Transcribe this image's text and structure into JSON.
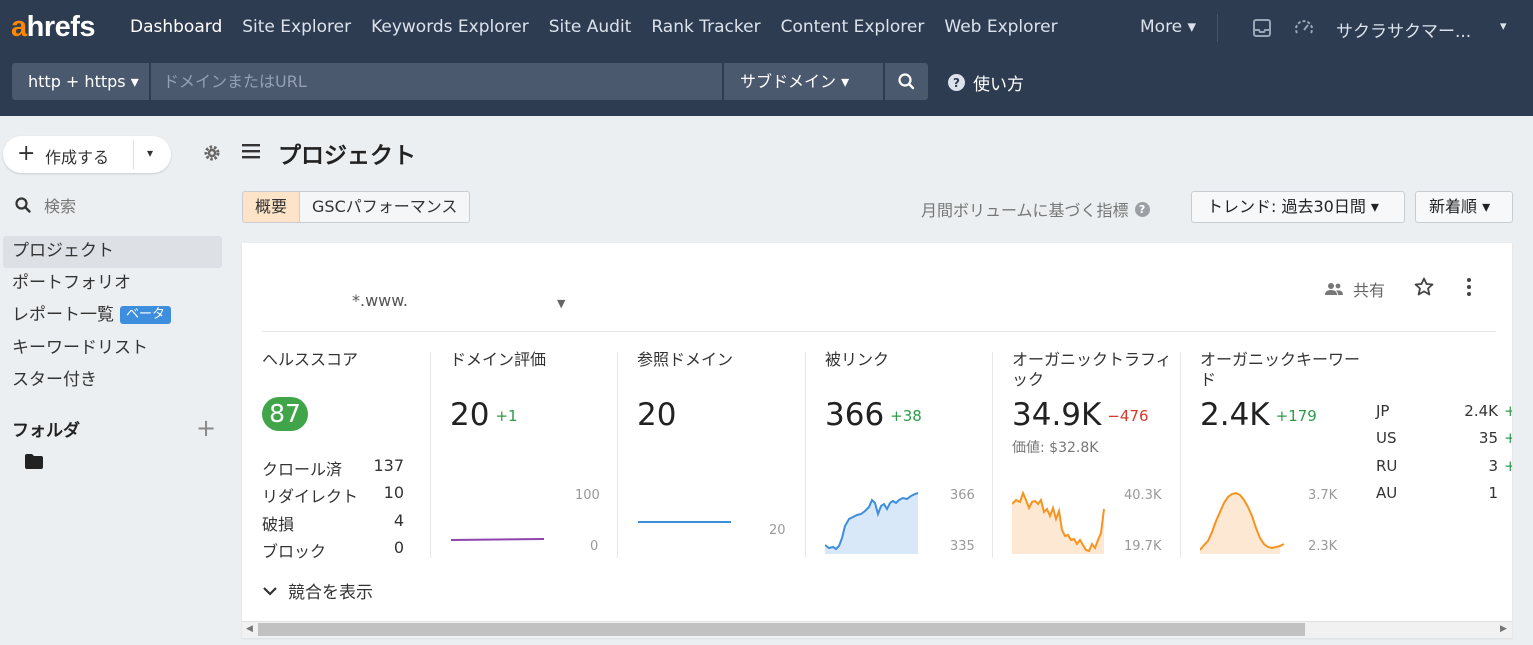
{
  "topnav": {
    "logo_a": "a",
    "logo_rest": "hrefs",
    "items": [
      {
        "label": "Dashboard",
        "active": true
      },
      {
        "label": "Site Explorer"
      },
      {
        "label": "Keywords Explorer"
      },
      {
        "label": "Site Audit"
      },
      {
        "label": "Rank Tracker"
      },
      {
        "label": "Content Explorer"
      },
      {
        "label": "Web Explorer"
      }
    ],
    "more": "More ▾",
    "account": "サクラサクマー...",
    "account_caret": "▾"
  },
  "searchbar": {
    "protocol": "http + https ▾",
    "placeholder": "ドメインまたはURL",
    "mode": "サブドメイン ▾",
    "help": "使い方",
    "help_glyph": "?"
  },
  "sidebar": {
    "create_plus": "+",
    "create_label": "作成する",
    "create_caret": "▾",
    "search_label": "検索",
    "items": [
      {
        "label": "プロジェクト",
        "active": true
      },
      {
        "label": "ポートフォリオ"
      },
      {
        "label": "レポート一覧",
        "badge": "ベータ"
      },
      {
        "label": "キーワードリスト"
      },
      {
        "label": "スター付き"
      }
    ],
    "folder_heading": "フォルダ",
    "folder_add": "+"
  },
  "main": {
    "title": "プロジェクト",
    "tabs": [
      "概要",
      "GSCパフォーマンス"
    ],
    "metric_note": "月間ボリュームに基づく指標",
    "metric_note_glyph": "?",
    "trend_button": "トレンド: 過去30日間 ▾",
    "sort_button": "新着順 ▾"
  },
  "project": {
    "domain": "*.www.",
    "domain_caret": "▼",
    "share_label": "共有",
    "show_competitors": "競合を表示",
    "health": {
      "label": "ヘルススコア",
      "score": "87",
      "rows": [
        {
          "label": "クロール済",
          "value": "137"
        },
        {
          "label": "リダイレクト",
          "value": "10"
        },
        {
          "label": "破損",
          "value": "4"
        },
        {
          "label": "ブロック",
          "value": "0"
        }
      ]
    },
    "domain_rating": {
      "label": "ドメイン評価",
      "value": "20",
      "delta": "+1",
      "axis_top": "100",
      "axis_bottom": "0"
    },
    "referring_domains": {
      "label": "参照ドメイン",
      "value": "20",
      "axis": "20"
    },
    "backlinks": {
      "label": "被リンク",
      "value": "366",
      "delta": "+38",
      "axis_top": "366",
      "axis_bottom": "335"
    },
    "organic_traffic": {
      "label": "オーガニックトラフィック",
      "value": "34.9K",
      "delta": "−476",
      "subvalue": "価値: $32.8K",
      "axis_top": "40.3K",
      "axis_bottom": "19.7K"
    },
    "organic_keywords": {
      "label": "オーガニックキーワード",
      "value": "2.4K",
      "delta": "+179",
      "axis_top": "3.7K",
      "axis_bottom": "2.3K"
    },
    "countries": [
      {
        "code": "JP",
        "value": "2.4K",
        "delta": "+"
      },
      {
        "code": "US",
        "value": "35",
        "delta": "+"
      },
      {
        "code": "RU",
        "value": "3",
        "delta": "+"
      },
      {
        "code": "AU",
        "value": "1",
        "delta": ""
      }
    ]
  },
  "colors": {
    "topbar": "#2e3c51",
    "brand_orange": "#ff8800",
    "health_green": "#3fa548",
    "backlinks_blue": "#3e8ede",
    "traffic_orange": "#f7931e",
    "dr_purple": "#8e44ad"
  },
  "icons": [
    "search-icon",
    "help-icon",
    "inbox-icon",
    "gauge-icon",
    "gear-icon",
    "menu-icon",
    "folder-icon",
    "share-icon",
    "star-icon",
    "kebab-icon",
    "chevron-down-icon"
  ]
}
